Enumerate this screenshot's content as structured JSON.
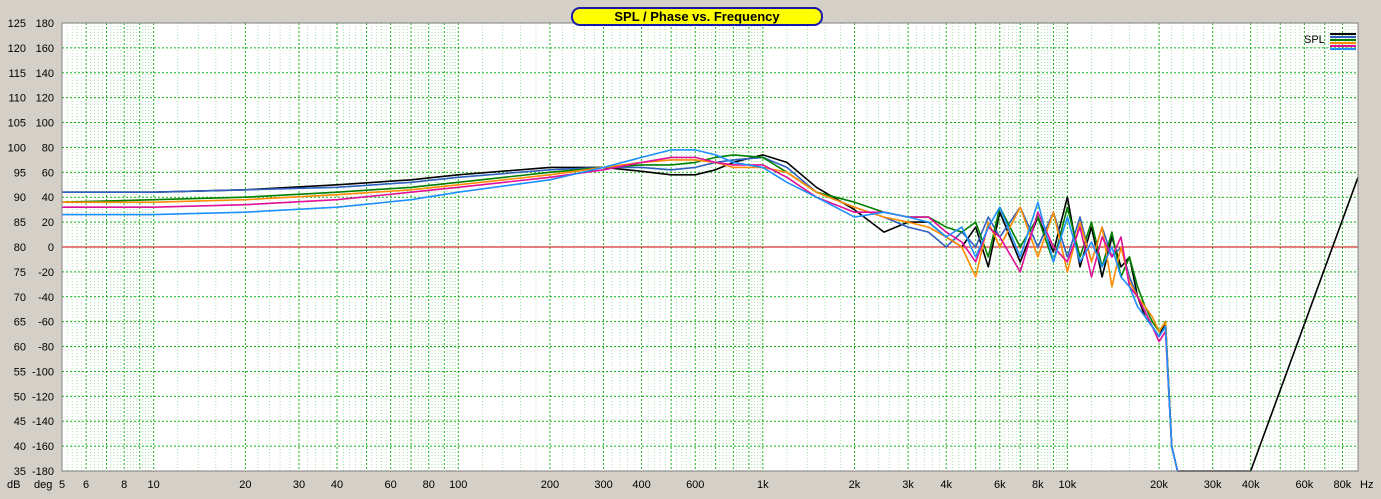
{
  "chart_data": {
    "type": "line",
    "title": "SPL / Phase vs. Frequency",
    "x_scale": "log",
    "xlim": [
      5,
      90000
    ],
    "y_left_unit": "dB",
    "y_right_unit": "deg",
    "x_unit": "Hz",
    "ylim_spl": [
      35,
      125
    ],
    "ylim_phase": [
      -180,
      180
    ],
    "y_ticks_spl": [
      125,
      120,
      115,
      110,
      105,
      100,
      95,
      90,
      85,
      80,
      75,
      70,
      65,
      60,
      55,
      50,
      45,
      40,
      35
    ],
    "y_ticks_phase": [
      180,
      160,
      140,
      120,
      100,
      80,
      60,
      40,
      20,
      0,
      -20,
      -40,
      -60,
      -80,
      -100,
      -120,
      -140,
      -160,
      -180
    ],
    "x_tick_labels": [
      {
        "v": 5,
        "t": "5"
      },
      {
        "v": 6,
        "t": "6"
      },
      {
        "v": 8,
        "t": "8"
      },
      {
        "v": 10,
        "t": "10"
      },
      {
        "v": 20,
        "t": "20"
      },
      {
        "v": 30,
        "t": "30"
      },
      {
        "v": 40,
        "t": "40"
      },
      {
        "v": 60,
        "t": "60"
      },
      {
        "v": 80,
        "t": "80"
      },
      {
        "v": 100,
        "t": "100"
      },
      {
        "v": 200,
        "t": "200"
      },
      {
        "v": 300,
        "t": "300"
      },
      {
        "v": 400,
        "t": "400"
      },
      {
        "v": 600,
        "t": "600"
      },
      {
        "v": 1000,
        "t": "1k"
      },
      {
        "v": 2000,
        "t": "2k"
      },
      {
        "v": 3000,
        "t": "3k"
      },
      {
        "v": 4000,
        "t": "4k"
      },
      {
        "v": 6000,
        "t": "6k"
      },
      {
        "v": 8000,
        "t": "8k"
      },
      {
        "v": 10000,
        "t": "10k"
      },
      {
        "v": 20000,
        "t": "20k"
      },
      {
        "v": 30000,
        "t": "30k"
      },
      {
        "v": 40000,
        "t": "40k"
      },
      {
        "v": 60000,
        "t": "60k"
      },
      {
        "v": 80000,
        "t": "80k"
      }
    ],
    "grid": true,
    "legend": {
      "label": "SPL",
      "position": "top-right"
    },
    "reference_line": {
      "axis": "phase",
      "value": 0,
      "color": "#cc0000"
    },
    "colors": {
      "background": "#ffffff",
      "grid": "#00aa00",
      "frame": "#d4d0c8",
      "title_bg": "#ffff00",
      "title_border": "#1a1aa8"
    },
    "series": [
      {
        "color": "#000000",
        "points": [
          [
            5,
            91
          ],
          [
            10,
            91
          ],
          [
            20,
            91.5
          ],
          [
            40,
            92.5
          ],
          [
            70,
            93.5
          ],
          [
            100,
            94.5
          ],
          [
            200,
            96
          ],
          [
            300,
            96
          ],
          [
            400,
            95.2
          ],
          [
            500,
            94.5
          ],
          [
            600,
            94.5
          ],
          [
            700,
            95.5
          ],
          [
            800,
            97
          ],
          [
            1000,
            98.5
          ],
          [
            1200,
            97
          ],
          [
            1500,
            92
          ],
          [
            2000,
            87.5
          ],
          [
            2500,
            83
          ],
          [
            3000,
            85
          ],
          [
            3500,
            85
          ],
          [
            4000,
            82
          ],
          [
            4500,
            80
          ],
          [
            5000,
            84
          ],
          [
            5500,
            76
          ],
          [
            6000,
            87
          ],
          [
            7000,
            77
          ],
          [
            8000,
            86
          ],
          [
            9000,
            79
          ],
          [
            10000,
            90
          ],
          [
            11000,
            76
          ],
          [
            12000,
            84
          ],
          [
            13000,
            74
          ],
          [
            14000,
            82
          ],
          [
            15000,
            76
          ],
          [
            16000,
            78
          ],
          [
            17000,
            70
          ],
          [
            18000,
            66
          ],
          [
            19000,
            64
          ],
          [
            20000,
            62
          ],
          [
            21000,
            65
          ],
          [
            22000,
            40
          ],
          [
            23000,
            35
          ],
          [
            40000,
            35
          ],
          [
            90000,
            94
          ]
        ]
      },
      {
        "color": "#3060c0",
        "points": [
          [
            5,
            91
          ],
          [
            10,
            91
          ],
          [
            20,
            91.5
          ],
          [
            40,
            92
          ],
          [
            70,
            93
          ],
          [
            100,
            94
          ],
          [
            200,
            95.5
          ],
          [
            300,
            96
          ],
          [
            400,
            96
          ],
          [
            500,
            95.5
          ],
          [
            600,
            96
          ],
          [
            700,
            97
          ],
          [
            800,
            97.5
          ],
          [
            1000,
            98
          ],
          [
            1200,
            96
          ],
          [
            1500,
            91
          ],
          [
            2000,
            88
          ],
          [
            2500,
            86
          ],
          [
            3000,
            84
          ],
          [
            3500,
            83
          ],
          [
            4000,
            80
          ],
          [
            4500,
            83
          ],
          [
            5000,
            80
          ],
          [
            5500,
            86
          ],
          [
            6000,
            82
          ],
          [
            7000,
            88
          ],
          [
            8000,
            80
          ],
          [
            9000,
            87
          ],
          [
            10000,
            78
          ],
          [
            11000,
            86
          ],
          [
            12000,
            77
          ],
          [
            13000,
            84
          ],
          [
            14000,
            78
          ],
          [
            15000,
            80
          ],
          [
            16000,
            74
          ],
          [
            17000,
            70
          ],
          [
            18000,
            67
          ],
          [
            19000,
            64
          ],
          [
            20000,
            62
          ],
          [
            21000,
            64
          ],
          [
            22000,
            40
          ],
          [
            23000,
            35
          ]
        ]
      },
      {
        "color": "#008000",
        "points": [
          [
            5,
            89
          ],
          [
            10,
            89.5
          ],
          [
            20,
            90
          ],
          [
            40,
            91
          ],
          [
            70,
            92
          ],
          [
            100,
            93
          ],
          [
            200,
            95
          ],
          [
            300,
            96
          ],
          [
            400,
            96.5
          ],
          [
            500,
            96.5
          ],
          [
            600,
            97
          ],
          [
            700,
            98
          ],
          [
            800,
            98.5
          ],
          [
            1000,
            98
          ],
          [
            1200,
            95
          ],
          [
            1500,
            91
          ],
          [
            2000,
            89
          ],
          [
            2500,
            87
          ],
          [
            3000,
            86
          ],
          [
            3500,
            86
          ],
          [
            4000,
            84
          ],
          [
            4500,
            83
          ],
          [
            5000,
            85
          ],
          [
            5500,
            78
          ],
          [
            6000,
            88
          ],
          [
            7000,
            80
          ],
          [
            8000,
            86
          ],
          [
            9000,
            77
          ],
          [
            10000,
            88
          ],
          [
            11000,
            78
          ],
          [
            12000,
            85
          ],
          [
            13000,
            76
          ],
          [
            14000,
            83
          ],
          [
            15000,
            74
          ],
          [
            16000,
            78
          ],
          [
            17000,
            72
          ],
          [
            18000,
            68
          ],
          [
            19000,
            65
          ],
          [
            20000,
            63
          ],
          [
            21000,
            65
          ],
          [
            22000,
            40
          ],
          [
            23000,
            35
          ]
        ]
      },
      {
        "color": "#ff8c00",
        "points": [
          [
            5,
            89
          ],
          [
            10,
            89
          ],
          [
            20,
            89.5
          ],
          [
            40,
            90.5
          ],
          [
            70,
            91.5
          ],
          [
            100,
            92.5
          ],
          [
            200,
            94.5
          ],
          [
            300,
            96
          ],
          [
            400,
            97
          ],
          [
            500,
            97.5
          ],
          [
            600,
            97.5
          ],
          [
            700,
            97
          ],
          [
            800,
            96
          ],
          [
            1000,
            96
          ],
          [
            1200,
            95
          ],
          [
            1500,
            91
          ],
          [
            2000,
            88
          ],
          [
            2500,
            86
          ],
          [
            3000,
            85
          ],
          [
            3500,
            84
          ],
          [
            4000,
            82
          ],
          [
            4500,
            80
          ],
          [
            5000,
            74
          ],
          [
            5500,
            85
          ],
          [
            6000,
            80
          ],
          [
            7000,
            88
          ],
          [
            8000,
            78
          ],
          [
            9000,
            87
          ],
          [
            10000,
            75
          ],
          [
            11000,
            85
          ],
          [
            12000,
            77
          ],
          [
            13000,
            84
          ],
          [
            14000,
            72
          ],
          [
            15000,
            80
          ],
          [
            16000,
            73
          ],
          [
            17000,
            70
          ],
          [
            18000,
            68
          ],
          [
            19000,
            66
          ],
          [
            20000,
            63
          ],
          [
            21000,
            65
          ],
          [
            22000,
            40
          ],
          [
            23000,
            35
          ]
        ]
      },
      {
        "color": "#e0109a",
        "points": [
          [
            5,
            88
          ],
          [
            10,
            88
          ],
          [
            20,
            88.5
          ],
          [
            40,
            89.5
          ],
          [
            70,
            91
          ],
          [
            100,
            92
          ],
          [
            200,
            94
          ],
          [
            300,
            95.5
          ],
          [
            400,
            97
          ],
          [
            500,
            98
          ],
          [
            600,
            98
          ],
          [
            700,
            97
          ],
          [
            800,
            96.5
          ],
          [
            1000,
            96.5
          ],
          [
            1200,
            94
          ],
          [
            1500,
            90
          ],
          [
            2000,
            87
          ],
          [
            2500,
            87
          ],
          [
            3000,
            86
          ],
          [
            3500,
            86
          ],
          [
            4000,
            83
          ],
          [
            4500,
            81
          ],
          [
            5000,
            77
          ],
          [
            5500,
            84
          ],
          [
            6000,
            82
          ],
          [
            7000,
            75
          ],
          [
            8000,
            87
          ],
          [
            9000,
            80
          ],
          [
            10000,
            77
          ],
          [
            11000,
            84
          ],
          [
            12000,
            74
          ],
          [
            13000,
            82
          ],
          [
            14000,
            78
          ],
          [
            15000,
            82
          ],
          [
            16000,
            72
          ],
          [
            17000,
            70
          ],
          [
            18000,
            67
          ],
          [
            19000,
            64
          ],
          [
            20000,
            61
          ],
          [
            21000,
            63
          ],
          [
            22000,
            40
          ],
          [
            23000,
            35
          ]
        ]
      },
      {
        "color": "#1e90ff",
        "points": [
          [
            5,
            86.5
          ],
          [
            10,
            86.5
          ],
          [
            20,
            87
          ],
          [
            40,
            88
          ],
          [
            70,
            89.5
          ],
          [
            100,
            91
          ],
          [
            200,
            93.5
          ],
          [
            300,
            96
          ],
          [
            400,
            98
          ],
          [
            500,
            99.5
          ],
          [
            600,
            99.5
          ],
          [
            700,
            98.5
          ],
          [
            800,
            97
          ],
          [
            1000,
            96
          ],
          [
            1200,
            93
          ],
          [
            1500,
            90
          ],
          [
            2000,
            86
          ],
          [
            2500,
            87
          ],
          [
            3000,
            86
          ],
          [
            3500,
            85
          ],
          [
            4000,
            82
          ],
          [
            4500,
            84
          ],
          [
            5000,
            78
          ],
          [
            5500,
            84
          ],
          [
            6000,
            88
          ],
          [
            7000,
            78
          ],
          [
            8000,
            89
          ],
          [
            9000,
            77
          ],
          [
            10000,
            86
          ],
          [
            11000,
            77
          ],
          [
            12000,
            81
          ],
          [
            13000,
            76
          ],
          [
            14000,
            80
          ],
          [
            15000,
            74
          ],
          [
            16000,
            72
          ],
          [
            17000,
            68
          ],
          [
            18000,
            66
          ],
          [
            19000,
            64
          ],
          [
            20000,
            62
          ],
          [
            21000,
            64
          ],
          [
            22000,
            40
          ],
          [
            23000,
            35
          ]
        ]
      }
    ]
  }
}
